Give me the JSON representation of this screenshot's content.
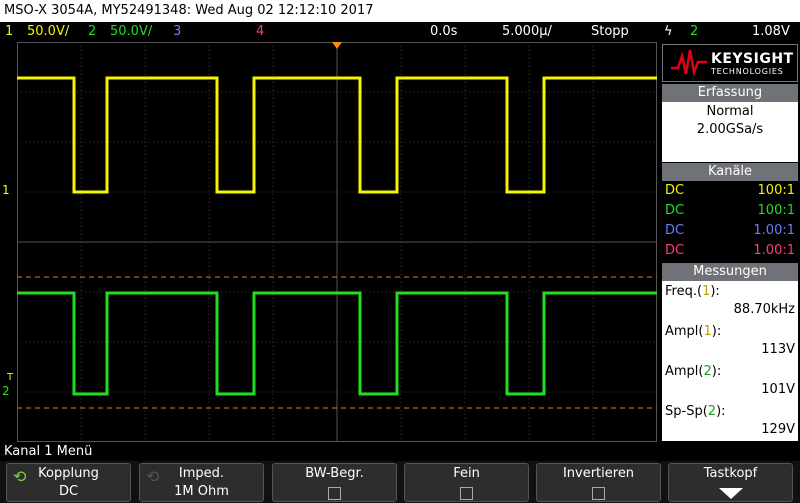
{
  "title": "MSO-X 3054A, MY52491348: Wed Aug 02 12:12:10 2017",
  "status": {
    "ch1_num": "1",
    "ch1_scale": "50.0V/",
    "ch2_num": "2",
    "ch2_scale": "50.0V/",
    "ch3_num": "3",
    "ch4_num": "4",
    "time_offset": "0.0s",
    "time_scale": "5.000µ/",
    "run_state": "Stopp",
    "trigger_symbol": "ϟ",
    "trigger_source": "2",
    "trigger_level": "1.08V"
  },
  "colors": {
    "ch1": "#f5f500",
    "ch2": "#22dd22",
    "ch3": "#6b7bff",
    "ch4": "#ff3a78",
    "ref": "#e07a2a",
    "logo_red": "#e0001b"
  },
  "logo": {
    "brand": "KEYSIGHT",
    "sub": "TECHNOLOGIES"
  },
  "acquisition": {
    "header": "Erfassung",
    "mode": "Normal",
    "rate": "2.00GSa/s"
  },
  "channels": {
    "header": "Kanäle",
    "rows": [
      {
        "coupling": "DC",
        "probe": "100:1"
      },
      {
        "coupling": "DC",
        "probe": "100:1"
      },
      {
        "coupling": "DC",
        "probe": "1.00:1"
      },
      {
        "coupling": "DC",
        "probe": "1.00:1"
      }
    ]
  },
  "measurements": {
    "header": "Messungen",
    "items": [
      {
        "name": "Freq.",
        "src": "1",
        "value": "88.70kHz"
      },
      {
        "name": "Ampl",
        "src": "1",
        "value": "113V"
      },
      {
        "name": "Ampl",
        "src": "2",
        "value": "101V"
      },
      {
        "name": "Sp-Sp",
        "src": "2",
        "value": "129V"
      }
    ]
  },
  "markers": {
    "ch1": "1",
    "ch2": "2",
    "trig_t": "T"
  },
  "menu_label": "Kanal 1 Menü",
  "softkeys": [
    {
      "title": "Kopplung",
      "value": "DC"
    },
    {
      "title": "Imped.",
      "value": "1M Ohm"
    },
    {
      "title": "BW-Begr."
    },
    {
      "title": "Fein"
    },
    {
      "title": "Invertieren"
    },
    {
      "title": "Tastkopf"
    }
  ]
}
